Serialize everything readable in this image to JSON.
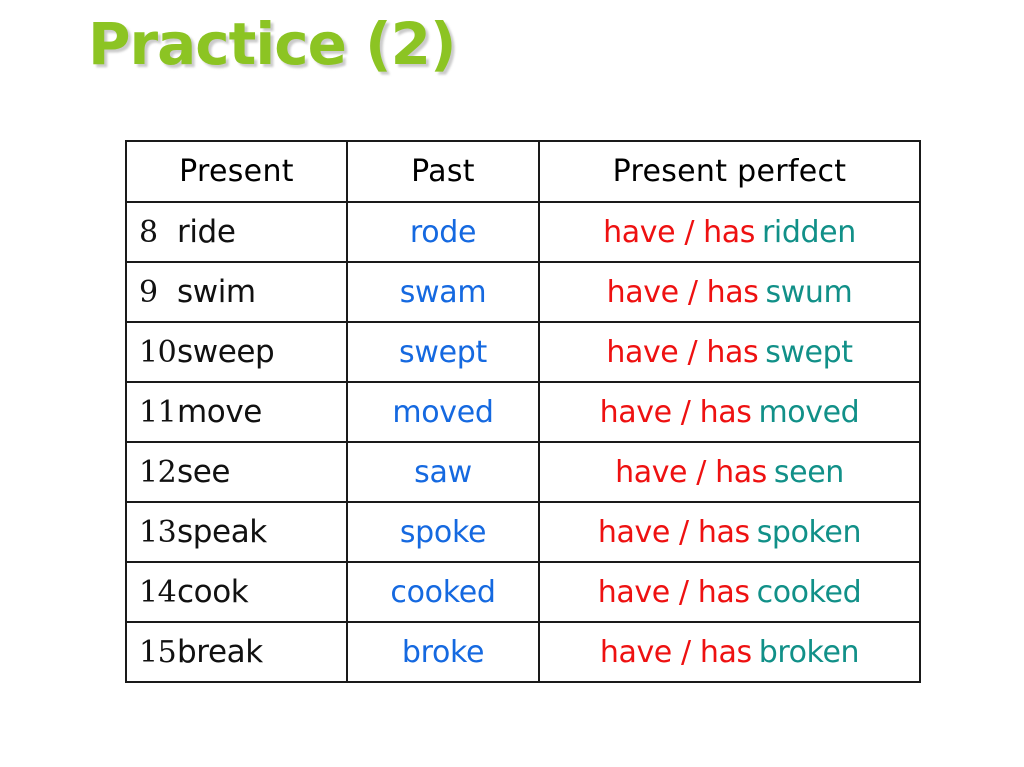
{
  "slide": {
    "title": "Practice (2)",
    "title_color": "#8CC423",
    "background_color": "#FFFFFF"
  },
  "colors": {
    "present": "#111111",
    "past": "#1569E0",
    "auxiliary": "#EE1111",
    "participle": "#119088",
    "border": "#1A1A1A"
  },
  "table": {
    "headers": {
      "present": "Present",
      "past": "Past",
      "present_perfect": "Present perfect"
    },
    "auxiliary_label": "have / has",
    "rows": [
      {
        "number": "8",
        "present": "ride",
        "past": "rode",
        "participle": "ridden"
      },
      {
        "number": "9",
        "present": "swim",
        "past": "swam",
        "participle": "swum"
      },
      {
        "number": "10",
        "present": "sweep",
        "past": "swept",
        "participle": "swept"
      },
      {
        "number": "11",
        "present": "move",
        "past": "moved",
        "participle": "moved"
      },
      {
        "number": "12",
        "present": "see",
        "past": "saw",
        "participle": "seen"
      },
      {
        "number": "13",
        "present": "speak",
        "past": "spoke",
        "participle": "spoken"
      },
      {
        "number": "14",
        "present": "cook",
        "past": "cooked",
        "participle": "cooked"
      },
      {
        "number": "15",
        "present": "break",
        "past": "broke",
        "participle": "broken"
      }
    ]
  }
}
